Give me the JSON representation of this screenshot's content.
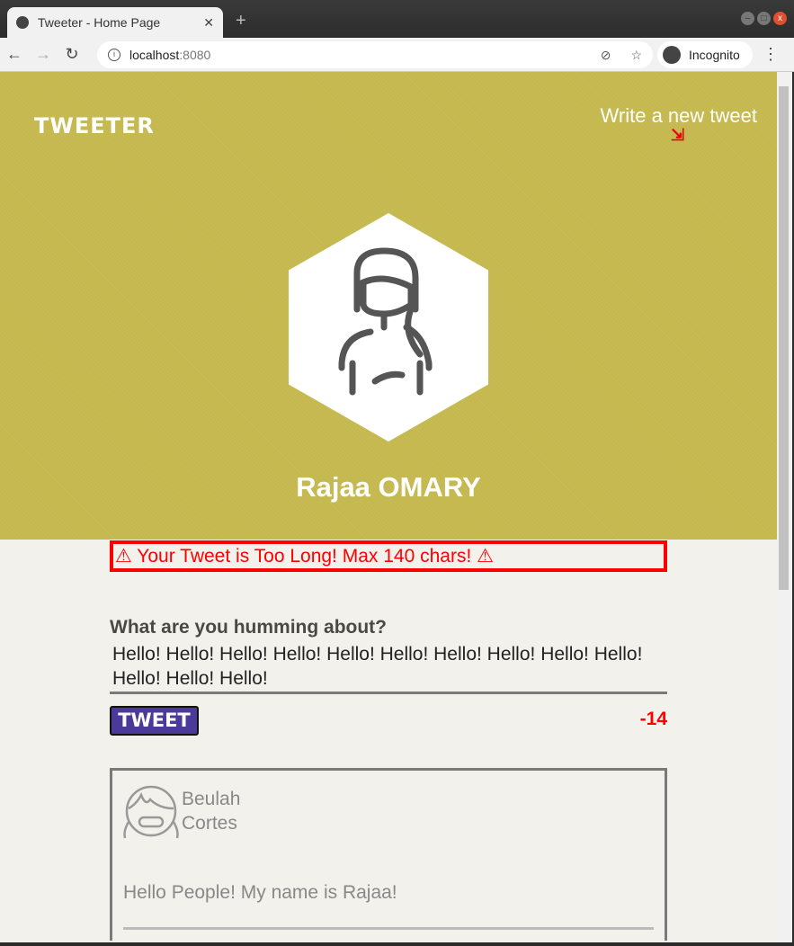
{
  "browser": {
    "tab_title": "Tweeter - Home Page",
    "url_host": "localhost",
    "url_port": ":8080",
    "profile": "Incognito"
  },
  "header": {
    "logo": "TWEETER",
    "write_link": "Write a new tweet",
    "arrow": "⇲"
  },
  "profile": {
    "name": "Rajaa OMARY"
  },
  "compose": {
    "error": "⚠ Your Tweet is Too Long! Max 140 chars! ⚠",
    "label": "What are you humming about?",
    "text": "Hello! Hello! Hello! Hello! Hello! Hello! Hello! Hello! Hello! Hello! Hello! Hello! Hello!",
    "button": "TWEET",
    "counter": "-14"
  },
  "tweets": [
    {
      "name_first": "Beulah",
      "name_last": "Cortes",
      "text": "Hello People! My name is Rajaa!"
    }
  ]
}
